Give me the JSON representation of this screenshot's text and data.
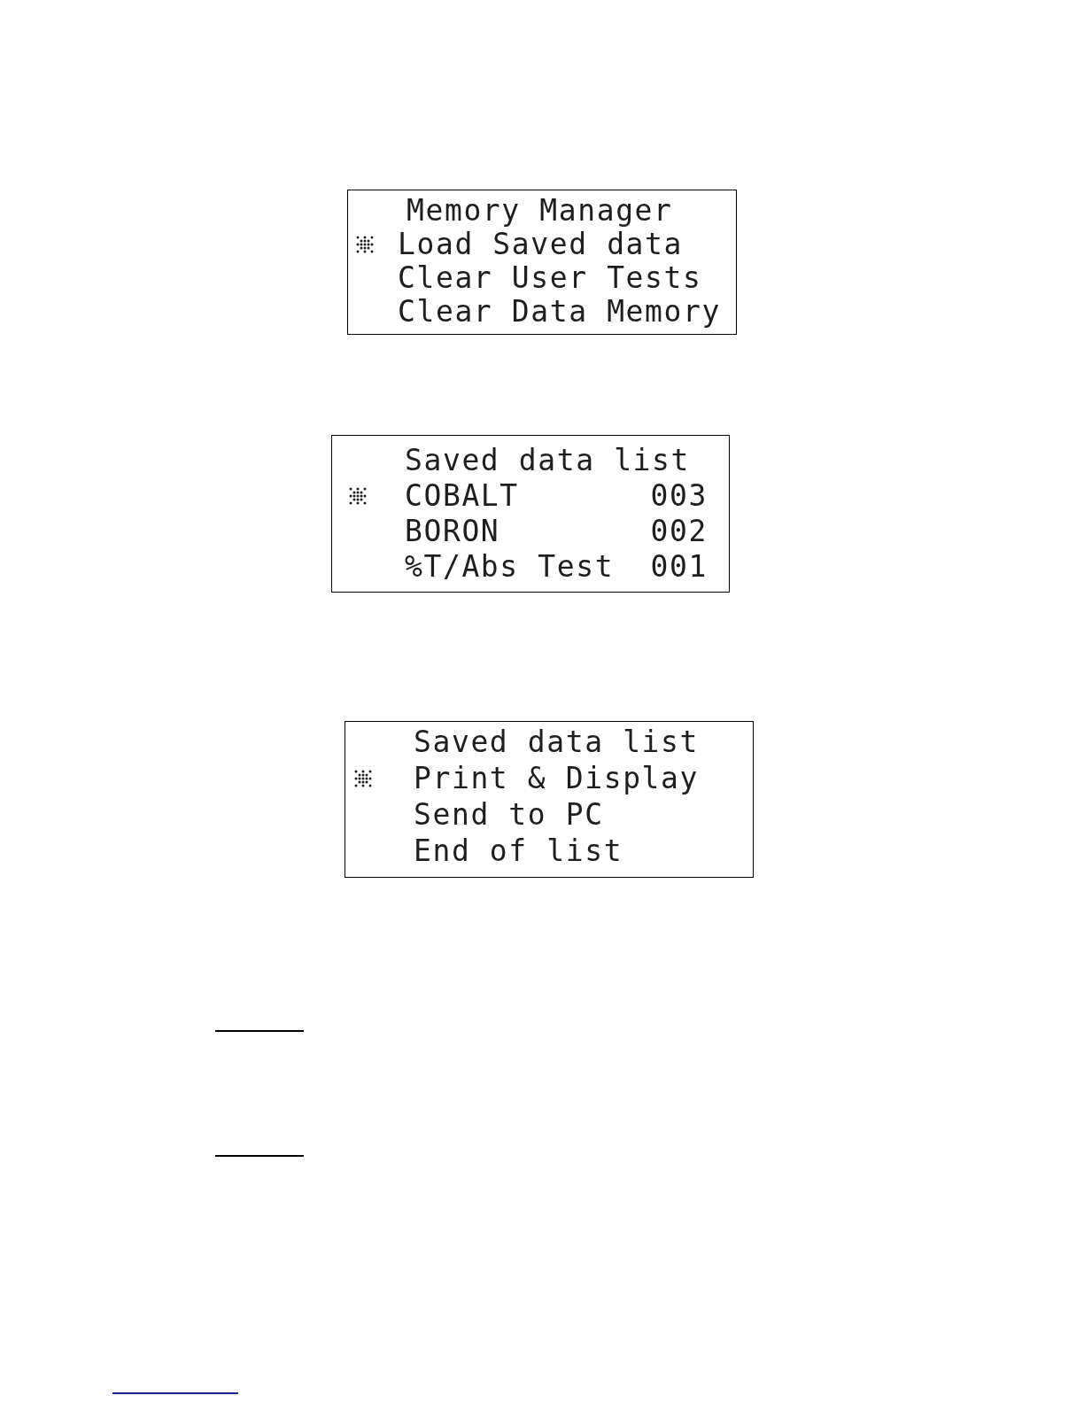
{
  "screens": [
    {
      "title": "Memory Manager",
      "items": [
        {
          "label": "Load Saved data",
          "selected": true
        },
        {
          "label": "Clear User Tests",
          "selected": false
        },
        {
          "label": "Clear Data Memory",
          "selected": false
        }
      ]
    },
    {
      "title": "Saved data list",
      "items": [
        {
          "label": "COBALT",
          "number": "003",
          "selected": true
        },
        {
          "label": "BORON",
          "number": "002",
          "selected": false
        },
        {
          "label": "%T/Abs Test",
          "number": "001",
          "selected": false
        }
      ]
    },
    {
      "title": "Saved data list",
      "items": [
        {
          "label": "Print & Display",
          "selected": true
        },
        {
          "label": "Send to PC",
          "selected": false
        },
        {
          "label": "End of list",
          "selected": false
        }
      ]
    }
  ]
}
